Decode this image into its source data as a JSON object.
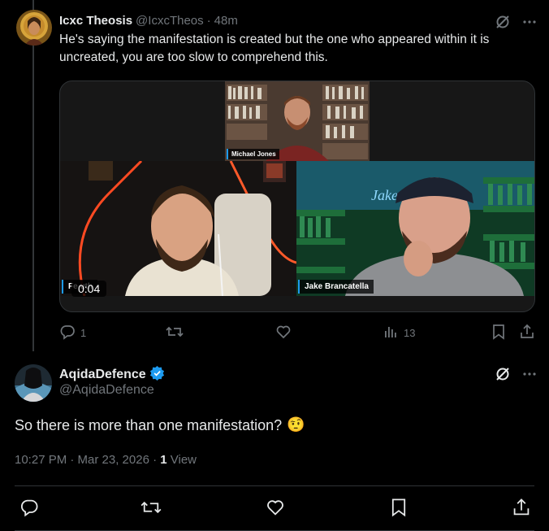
{
  "tweet1": {
    "name": "Icxc Theosis",
    "handle": "@IcxcTheos",
    "separator": "·",
    "time": "48m",
    "text": "He's saying the manifestation is created but the one who appeared within it is uncreated, you are too slow to comprehend this.",
    "media": {
      "label_top": "Michael Jones",
      "label_left": "Fe       uth",
      "label_right": "Jake Brancatella",
      "neon_text": "Jake        la",
      "timer": "0:04"
    },
    "actions": {
      "replies": "1",
      "retweets": "",
      "likes": "",
      "views": "13"
    }
  },
  "tweet2": {
    "name": "AqidaDefence",
    "handle": "@AqidaDefence",
    "text": "So there is more than one manifestation?",
    "emoji": "🤨",
    "meta_time": "10:27 PM · Mar 23, 2026 · ",
    "views_count": "1",
    "views_label": " View"
  },
  "colors": {
    "background": "#000000",
    "muted": "#71767b",
    "text": "#e7e9ea",
    "verified": "#1d9bf0",
    "divider": "#2f3336"
  },
  "icons": [
    "grok-icon",
    "more-icon",
    "reply-icon",
    "retweet-icon",
    "like-icon",
    "views-icon",
    "bookmark-icon",
    "share-icon",
    "verified-badge-icon"
  ]
}
